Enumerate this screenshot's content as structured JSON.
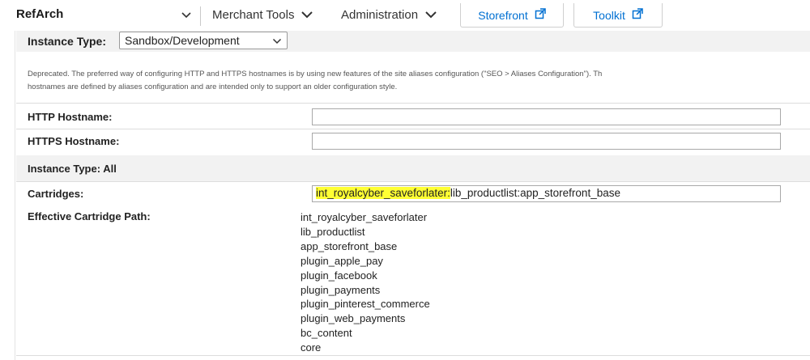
{
  "nav": {
    "site": "RefArch",
    "menus": [
      {
        "label": "Merchant Tools"
      },
      {
        "label": "Administration"
      }
    ],
    "buttons": [
      {
        "label": "Storefront"
      },
      {
        "label": "Toolkit"
      }
    ]
  },
  "instance_type": {
    "label": "Instance Type:",
    "selected": "Sandbox/Development"
  },
  "notice": {
    "line1": "Deprecated. The preferred way of configuring HTTP and HTTPS hostnames is by using new features of the site aliases configuration (\"SEO > Aliases Configuration\"). Th",
    "line2": "hostnames are defined by aliases configuration and are intended only to support an older configuration style."
  },
  "http_hostname": {
    "label": "HTTP Hostname:",
    "value": ""
  },
  "https_hostname": {
    "label": "HTTPS Hostname:",
    "value": ""
  },
  "instance_type_all": {
    "label": "Instance Type: All"
  },
  "cartridges": {
    "label": "Cartridges:",
    "highlighted": "int_royalcyber_saveforlater:",
    "rest": "lib_productlist:app_storefront_base",
    "highlight_color": "#ffff33"
  },
  "effective_path": {
    "label": "Effective Cartridge Path:",
    "items": [
      "int_royalcyber_saveforlater",
      "lib_productlist",
      "app_storefront_base",
      "plugin_apple_pay",
      "plugin_facebook",
      "plugin_payments",
      "plugin_pinterest_commerce",
      "plugin_web_payments",
      "bc_content",
      "core"
    ]
  },
  "icons": {
    "chevron": "chevron-down-icon",
    "external": "external-link-icon"
  },
  "colors": {
    "link_blue": "#0070d2",
    "panel_gray": "#f2f2f2",
    "highlight": "#ffff33"
  }
}
